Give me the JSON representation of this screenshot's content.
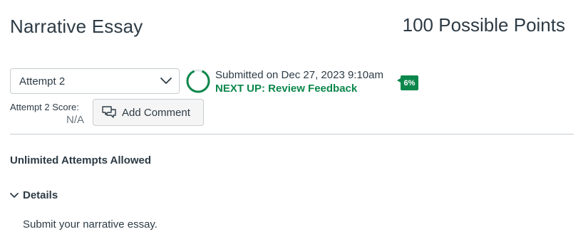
{
  "assignment": {
    "title": "Narrative Essay",
    "points": "100 Possible Points"
  },
  "attempt_select": {
    "selected": "Attempt 2"
  },
  "submission": {
    "submitted_text": "Submitted on Dec 27, 2023 9:10am",
    "next_up": "NEXT UP: Review Feedback",
    "progress_percent": 6,
    "progress_label": "6%"
  },
  "score": {
    "label": "Attempt 2 Score:",
    "value": "N/A"
  },
  "buttons": {
    "add_comment": "Add Comment"
  },
  "attempts_info": "Unlimited Attempts Allowed",
  "details": {
    "toggle_label": "Details",
    "body": "Submit your narrative essay."
  },
  "colors": {
    "accent_green": "#0b874b",
    "text": "#2d3b45",
    "border": "#c7cdd1"
  },
  "icons": [
    "chevron-down-icon",
    "progress-ring-icon",
    "comment-icon",
    "chevron-down-icon"
  ]
}
